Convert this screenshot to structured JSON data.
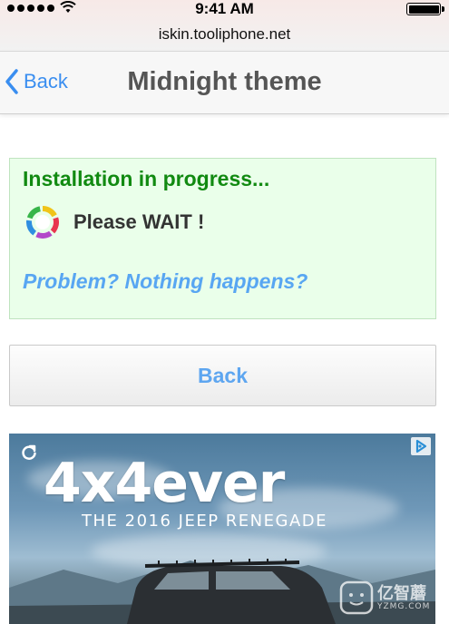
{
  "status_bar": {
    "time": "9:41 AM",
    "url": "iskin.tooliphone.net"
  },
  "nav": {
    "back_label": "Back",
    "title": "Midnight theme"
  },
  "install": {
    "title": "Installation in progress...",
    "wait_text": "Please WAIT !",
    "problem_link": "Problem? Nothing happens?"
  },
  "back_button_label": "Back",
  "ad": {
    "headline": "4x4ever",
    "subline": "THE 2016 JEEP RENEGADE",
    "choices_icon": "adchoices-icon",
    "refresh_icon": "refresh-icon"
  },
  "watermark": {
    "text": "亿智蘑",
    "sub": "YZMG.COM"
  },
  "colors": {
    "link_blue": "#3a8ef0",
    "install_green": "#118a11",
    "install_bg": "#eaffea",
    "problem_blue": "#58a6f2"
  }
}
